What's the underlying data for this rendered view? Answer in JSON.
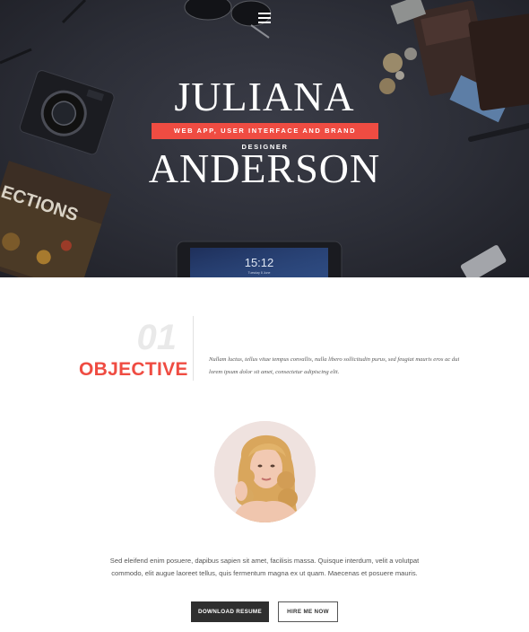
{
  "hero": {
    "menu_icon": "hamburger-icon",
    "first_name": "JULIANA",
    "last_name": "ANDERSON",
    "subtitle": "WEB APP, USER INTERFACE AND BRAND DESIGNER",
    "tablet_time": "15:12",
    "tablet_date": "Tuesday 8 June",
    "book_title": "ECTIONS",
    "accent_color": "#ef4c42"
  },
  "objective": {
    "number": "01",
    "title": "OBJECTIVE",
    "text_line1": "Nullam luctus, tellus vitae tempus convallis, nulla libero sollicitudin purus, sed feugiat mauris eros ac dui",
    "text_line2": "lorem ipsum dolor sit amet, consectetur adipiscing elit."
  },
  "bio": {
    "line1": "Sed eleifend enim posuere, dapibus sapien sit amet, facilisis massa. Quisque interdum, velit a volutpat",
    "line2": "commodo, elit augue laoreet tellus, quis fermentum magna ex ut quam. Maecenas et posuere mauris."
  },
  "actions": {
    "download_label": "DOWNLOAD RESUME",
    "hire_label": "HIRE ME NOW"
  }
}
